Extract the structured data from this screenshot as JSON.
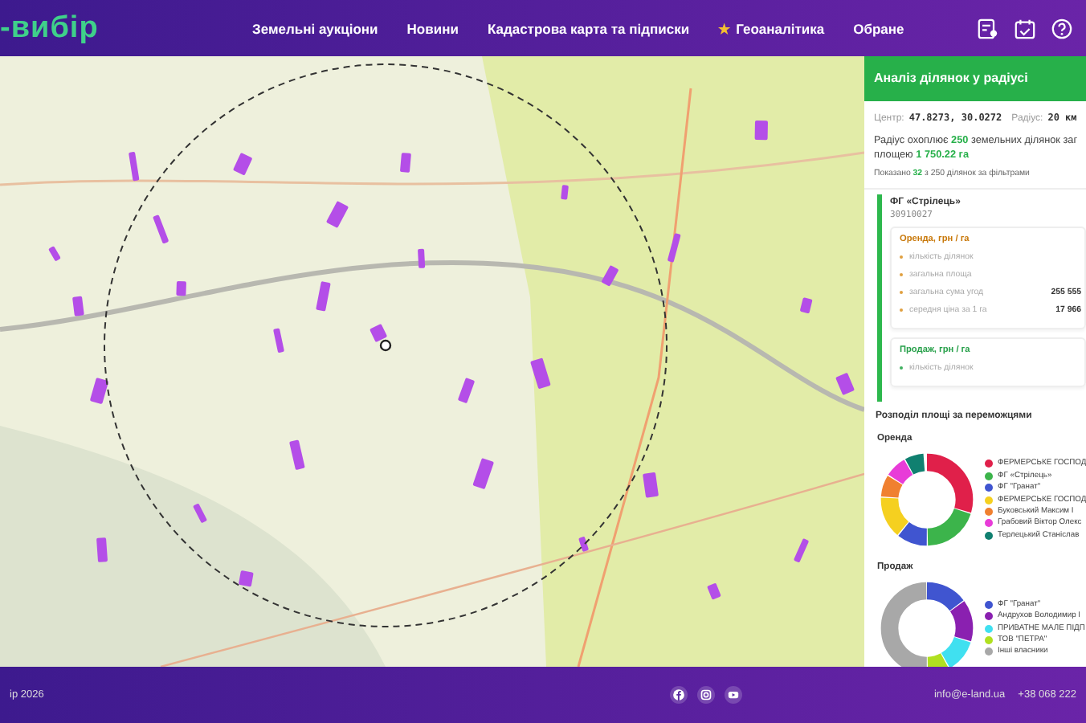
{
  "header": {
    "logo": "-вибір",
    "nav": [
      {
        "label": "Земельні аукціони",
        "starred": false
      },
      {
        "label": "Новини",
        "starred": false
      },
      {
        "label": "Кадастрова карта та підписки",
        "starred": false
      },
      {
        "label": "Геоаналітика",
        "starred": true,
        "icon": "★"
      },
      {
        "label": "Обране",
        "starred": false
      }
    ]
  },
  "panel": {
    "title": "Аналіз ділянок у радіусі",
    "center_label": "Центр:",
    "center_value": "47.8273, 30.0272",
    "radius_label": "Радіус:",
    "radius_value": "20 км",
    "summary": "Радіус охоплює **250** земельних ділянок заг площею **1 750.22 га**",
    "shown": "Показано **32** з 250 ділянок за фільтрами",
    "card": {
      "name": "ФГ «Стрілець»",
      "code": "30910027",
      "sections": [
        {
          "kind": "rent",
          "title": "Оренда, грн / га",
          "rows": [
            {
              "label": "кількість ділянок",
              "value": ""
            },
            {
              "label": "загальна площа",
              "value": ""
            },
            {
              "label": "загальна сума угод",
              "value": "255 555"
            },
            {
              "label": "середня ціна за 1 га",
              "value": "17 966"
            }
          ]
        },
        {
          "kind": "sale",
          "title": "Продаж, грн / га",
          "rows": [
            {
              "label": "кількість ділянок",
              "value": ""
            }
          ]
        }
      ]
    },
    "distribution_title": "Розподіл площі за переможцями",
    "groups": [
      {
        "title": "Оренда",
        "legend": [
          {
            "label": "ФЕРМЕРСЬКЕ ГОСПОД",
            "color": "#e0204a"
          },
          {
            "label": "ФГ «Стрілець»",
            "color": "#3cb44b"
          },
          {
            "label": "ФГ \"Гранат\"",
            "color": "#4055d0"
          },
          {
            "label": "ФЕРМЕРСЬКЕ ГОСПОД",
            "color": "#f5d020"
          },
          {
            "label": "Буковський Максим І",
            "color": "#f08030"
          },
          {
            "label": "Грабовий Віктор Олекс",
            "color": "#e83cd8"
          },
          {
            "label": "Терлецький Станіслав",
            "color": "#108070"
          }
        ]
      },
      {
        "title": "Продаж",
        "legend": [
          {
            "label": "ФГ \"Гранат\"",
            "color": "#4055d0"
          },
          {
            "label": "Андрухов Володимир І",
            "color": "#8a20b0"
          },
          {
            "label": "ПРИВАТНЕ МАЛЕ ПІДП",
            "color": "#40e0f0"
          },
          {
            "label": "ТОВ \"ПЕТРА\"",
            "color": "#b0e020"
          },
          {
            "label": "Інші власники",
            "color": "#a8a8a8"
          }
        ]
      }
    ]
  },
  "footer": {
    "copyright": "ір 2026",
    "email": "info@e-land.ua",
    "phone": "+38 068 222"
  }
}
